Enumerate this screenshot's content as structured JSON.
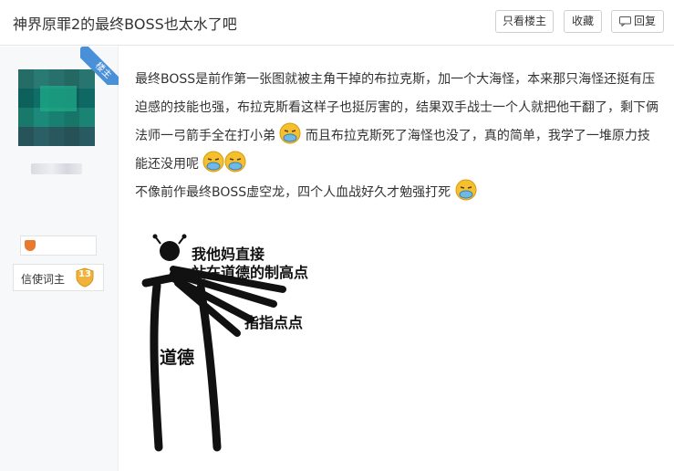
{
  "header": {
    "title": "神界原罪2的最终BOSS也太水了吧",
    "only_op_label": "只看楼主",
    "favorite_label": "收藏",
    "reply_label": "回复"
  },
  "corner_badge": {
    "label": "楼主",
    "color": "#4a90d9"
  },
  "sidebar": {
    "level_title": "信使词主",
    "level_number": "13"
  },
  "post": {
    "paragraphs": [
      "最终BOSS是前作第一张图就被主角干掉的布拉克斯，加一个大海怪，本来那只海怪还挺有压迫感的技能也强，布拉克斯看这样子也挺厉害的，结果双手战士一个人就把他干翻了，剩下俩法师一弓箭手全在打小弟",
      "而且布拉克斯死了海怪也没了，真的简单，我学了一堆原力技能还没用呢",
      "不像前作最终BOSS虚空龙，四个人血战好久才勉强打死"
    ],
    "emoji_name": "sick-face-emoji"
  },
  "meme": {
    "line1": "我他妈直接",
    "line2": "站在道德的制高点",
    "point_label": "指指点点",
    "stand_label": "道德"
  }
}
